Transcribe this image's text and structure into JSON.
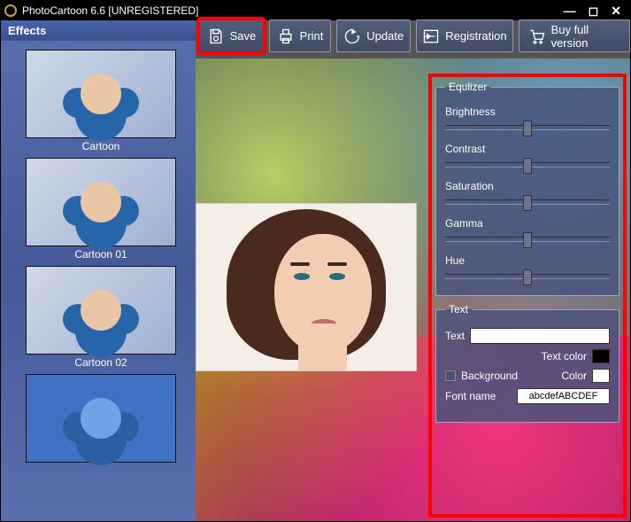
{
  "title": "PhotoCartoon 6.6 [UNREGISTERED]",
  "sidebar": {
    "header": "Effects",
    "items": [
      {
        "label": "Cartoon"
      },
      {
        "label": "Cartoon 01"
      },
      {
        "label": "Cartoon 02"
      },
      {
        "label": ""
      }
    ]
  },
  "toolbar": {
    "save": "Save",
    "print": "Print",
    "update": "Update",
    "registration": "Registration",
    "buy": "Buy full version"
  },
  "equalizer": {
    "legend": "Equlizer",
    "brightness": {
      "label": "Brightness",
      "value": 50
    },
    "contrast": {
      "label": "Contrast",
      "value": 50
    },
    "saturation": {
      "label": "Saturation",
      "value": 50
    },
    "gamma": {
      "label": "Gamma",
      "value": 50
    },
    "hue": {
      "label": "Hue",
      "value": 50
    }
  },
  "text_panel": {
    "legend": "Text",
    "text_label": "Text",
    "text_value": "",
    "text_color_label": "Text color",
    "text_color": "#000000",
    "background_label": "Background",
    "background_checked": false,
    "bg_color_label": "Color",
    "bg_color": "#ffffff",
    "font_label": "Font name",
    "font_name": "abcdefABCDEF"
  }
}
